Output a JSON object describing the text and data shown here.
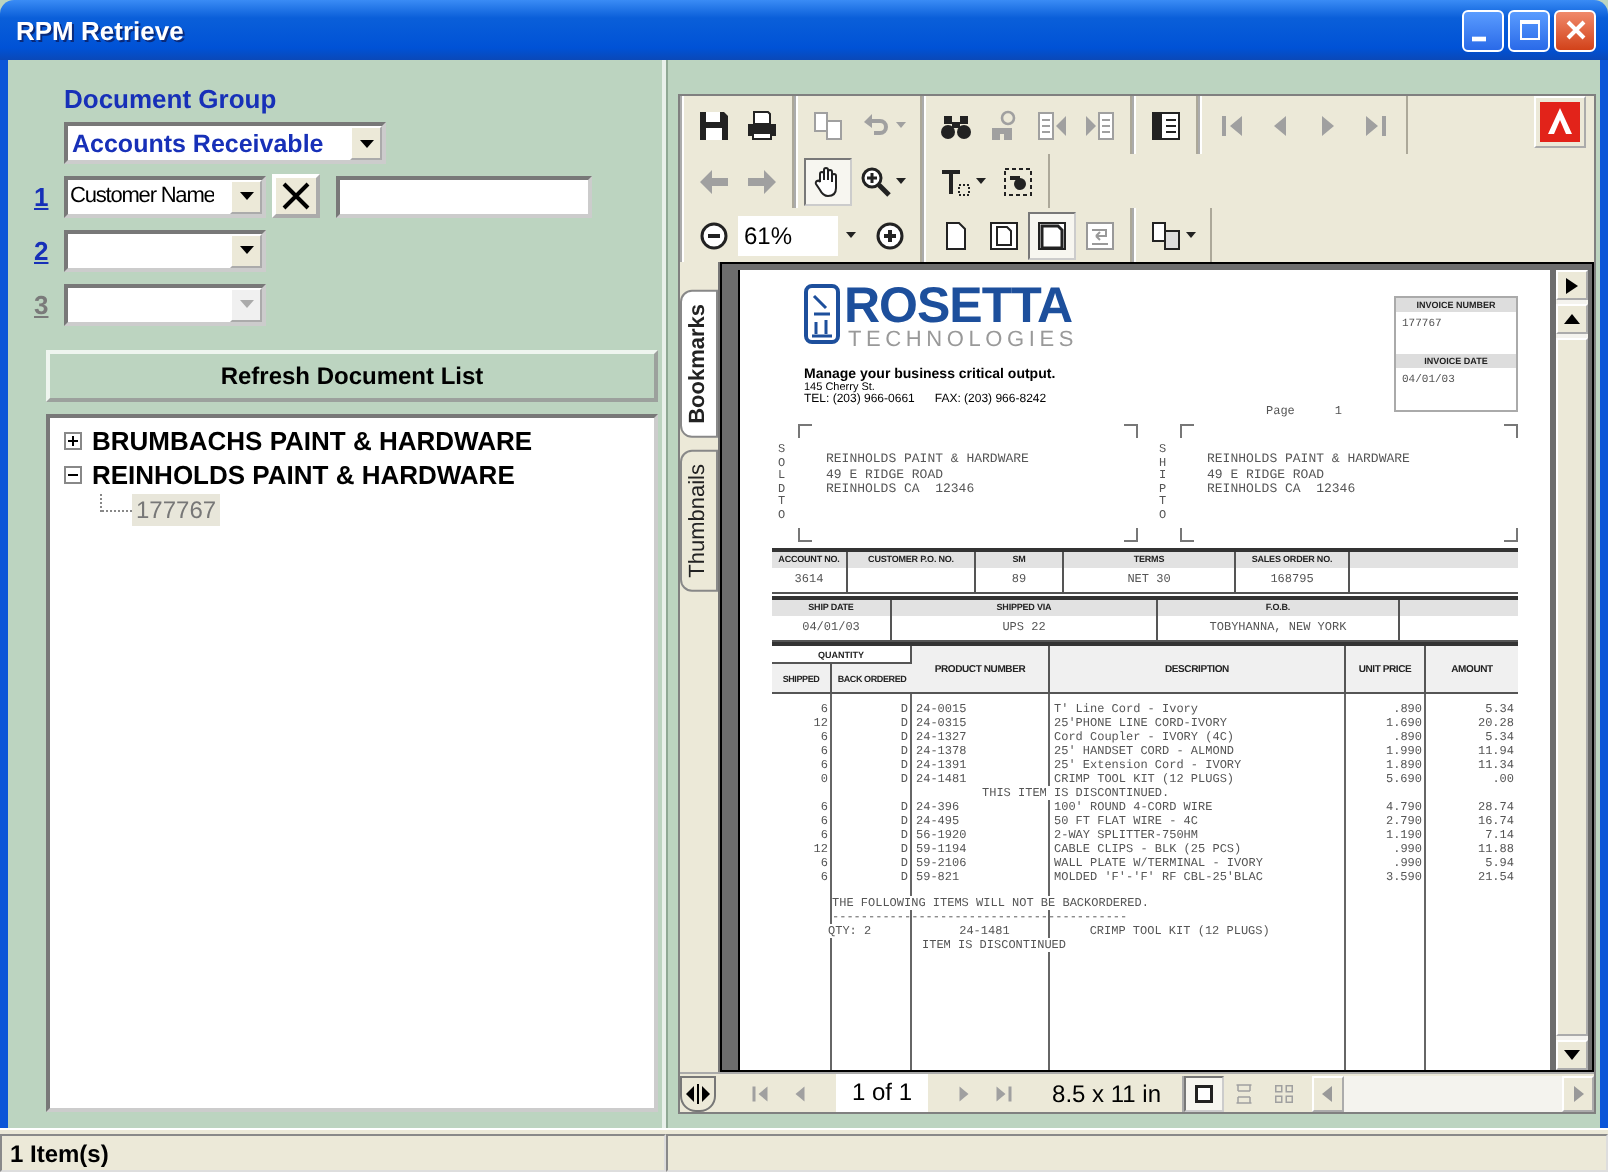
{
  "window": {
    "title": "RPM Retrieve"
  },
  "search_panel": {
    "document_group_label": "Document Group",
    "document_group": "Accounts Receivable",
    "criteria": [
      {
        "number": "1",
        "field": "Customer Name",
        "disabled": false
      },
      {
        "number": "2",
        "disabled": false
      },
      {
        "number": "3",
        "disabled": true
      }
    ],
    "refresh_button": "Refresh Document List",
    "tree": [
      {
        "label": "BRUMBACHS PAINT & HARDWARE",
        "expanded": false,
        "selected": false
      },
      {
        "label": "REINHOLDS PAINT & HARDWARE",
        "expanded": true,
        "selected": false,
        "children": [
          {
            "label": "177767",
            "selected": true
          }
        ]
      }
    ]
  },
  "viewer": {
    "toolbar_rows": [
      [
        [
          {
            "kind": "save",
            "disabled": false
          },
          {
            "kind": "print",
            "disabled": false
          }
        ],
        [
          {
            "kind": "copy",
            "disabled": true
          },
          {
            "kind": "undo",
            "disabled": true,
            "menu": true
          }
        ],
        [
          {
            "kind": "find",
            "disabled": false
          },
          {
            "kind": "search",
            "disabled": true
          },
          {
            "kind": "prev_doc",
            "disabled": true
          },
          {
            "kind": "next_doc",
            "disabled": true
          }
        ],
        [
          {
            "kind": "panel",
            "disabled": false
          }
        ],
        [
          {
            "kind": "first",
            "disabled": true
          },
          {
            "kind": "prev",
            "disabled": true
          },
          {
            "kind": "next",
            "disabled": true
          },
          {
            "kind": "last",
            "disabled": true
          }
        ]
      ],
      [
        [
          {
            "kind": "back",
            "disabled": true
          },
          {
            "kind": "forward",
            "disabled": true
          }
        ],
        [
          {
            "kind": "hand",
            "selected": true
          },
          {
            "kind": "zoom",
            "selected": false,
            "menu": true
          }
        ],
        [
          {
            "kind": "text_select",
            "selected": false,
            "menu": true
          },
          {
            "kind": "snapshot",
            "selected": false
          }
        ]
      ],
      [
        [
          {
            "kind": "zoom_out"
          },
          {
            "kind": "zoom_field",
            "value": "61%",
            "menu": true
          },
          {
            "kind": "zoom_in"
          }
        ],
        [
          {
            "kind": "actual_size",
            "selected": false
          },
          {
            "kind": "fit_page",
            "selected": false
          },
          {
            "kind": "fit_width",
            "selected": true
          },
          {
            "kind": "reflow",
            "selected": false
          }
        ],
        [
          {
            "kind": "layout",
            "menu": true
          }
        ]
      ]
    ],
    "side_tabs": [
      {
        "label": "Bookmarks",
        "selected": true
      },
      {
        "label": "Thumbnails",
        "selected": false
      }
    ],
    "document": {
      "logo": {
        "name": "ROSETTA",
        "subtitle": "TECHNOLOGIES"
      },
      "tagline": "Manage your business critical output.",
      "address": "145 Cherry St.",
      "phone": "TEL: (203) 966-0661",
      "fax": "FAX: (203) 966-8242",
      "invoice_number_label": "INVOICE NUMBER",
      "invoice_number": "177767",
      "invoice_date_label": "INVOICE DATE",
      "invoice_date": "04/01/03",
      "page_label": "Page",
      "page": "1",
      "sold_to_label": "SOLD TO",
      "sold_to": [
        "REINHOLDS PAINT & HARDWARE",
        "49 E RIDGE ROAD",
        "REINHOLDS CA  12346"
      ],
      "ship_to_label": "SHIP TO",
      "ship_to": [
        "REINHOLDS PAINT & HARDWARE",
        "49 E RIDGE ROAD",
        "REINHOLDS CA  12346"
      ],
      "order_fields": [
        {
          "label": "ACCOUNT NO.",
          "value": "3614"
        },
        {
          "label": "CUSTOMER P.O. NO."
        },
        {
          "label": "SM",
          "value": "89"
        },
        {
          "label": "TERMS",
          "value": "NET 30"
        },
        {
          "label": "SALES ORDER NO.",
          "value": "168795"
        }
      ],
      "shipping_fields": [
        {
          "label": "SHIP DATE",
          "value": "04/01/03"
        },
        {
          "label": "SHIPPED VIA",
          "value": "UPS 22"
        },
        {
          "label": "F.O.B.",
          "value": "TOBYHANNA, NEW YORK"
        }
      ],
      "quantity_label": "QUANTITY",
      "columns": [
        "SHIPPED",
        "BACK ORDERED",
        "PRODUCT NUMBER",
        "DESCRIPTION",
        "UNIT PRICE",
        "AMOUNT"
      ],
      "lines": [
        {
          "kind": "item",
          "cells": [
            "6",
            "D",
            "24-0015",
            "T' Line Cord - Ivory",
            ".890",
            "5.34"
          ]
        },
        {
          "kind": "item",
          "cells": [
            "12",
            "D",
            "24-0315",
            "25'PHONE LINE CORD-IVORY",
            "1.690",
            "20.28"
          ]
        },
        {
          "kind": "item",
          "cells": [
            "6",
            "D",
            "24-1327",
            "Cord Coupler - IVORY (4C)",
            ".890",
            "5.34"
          ]
        },
        {
          "kind": "item",
          "cells": [
            "6",
            "D",
            "24-1378",
            "25' HANDSET CORD - ALMOND",
            "1.990",
            "11.94"
          ]
        },
        {
          "kind": "item",
          "cells": [
            "6",
            "D",
            "24-1391",
            "25' Extension Cord - IVORY",
            "1.890",
            "11.34"
          ]
        },
        {
          "kind": "item",
          "cells": [
            "0",
            "D",
            "24-1481",
            "CRIMP TOOL KIT (12 PLUGS)",
            "5.690",
            ".00"
          ]
        },
        {
          "kind": "note",
          "text": "THIS ITEM IS DISCONTINUED."
        },
        {
          "kind": "item",
          "cells": [
            "6",
            "D",
            "24-396",
            "100' ROUND 4-CORD WIRE",
            "4.790",
            "28.74"
          ]
        },
        {
          "kind": "item",
          "cells": [
            "6",
            "D",
            "24-495",
            "50 FT FLAT WIRE - 4C",
            "2.790",
            "16.74"
          ]
        },
        {
          "kind": "item",
          "cells": [
            "6",
            "D",
            "56-1920",
            "2-WAY SPLITTER-750HM",
            "1.190",
            "7.14"
          ]
        },
        {
          "kind": "item",
          "cells": [
            "12",
            "D",
            "59-1194",
            "CABLE CLIPS - BLK (25 PCS)",
            ".990",
            "11.88"
          ]
        },
        {
          "kind": "item",
          "cells": [
            "6",
            "D",
            "59-2106",
            "WALL PLATE W/TERMINAL - IVORY",
            ".990",
            "5.94"
          ]
        },
        {
          "kind": "item",
          "cells": [
            "6",
            "D",
            "59-821",
            "MOLDED 'F'-'F' RF CBL-25'BLAC",
            "3.590",
            "21.54"
          ]
        },
        {
          "kind": "remark",
          "text": "THE FOLLOWING ITEMS WILL NOT BE BACKORDERED."
        },
        {
          "kind": "rule",
          "text": "-----------------------------------------"
        },
        {
          "kind": "backorder",
          "cells": [
            "QTY: 2",
            "24-1481",
            "CRIMP TOOL KIT (12 PLUGS)"
          ]
        },
        {
          "kind": "note",
          "text": "ITEM IS DISCONTINUED"
        }
      ]
    },
    "page_indicator": "1 of 1",
    "page_size": "8.5 x 11 in",
    "layouts": [
      {
        "kind": "single",
        "selected": true
      },
      {
        "kind": "continuous",
        "selected": false
      },
      {
        "kind": "facing",
        "selected": false
      }
    ]
  },
  "status_bar": {
    "panels": [
      "1 Item(s)"
    ]
  }
}
